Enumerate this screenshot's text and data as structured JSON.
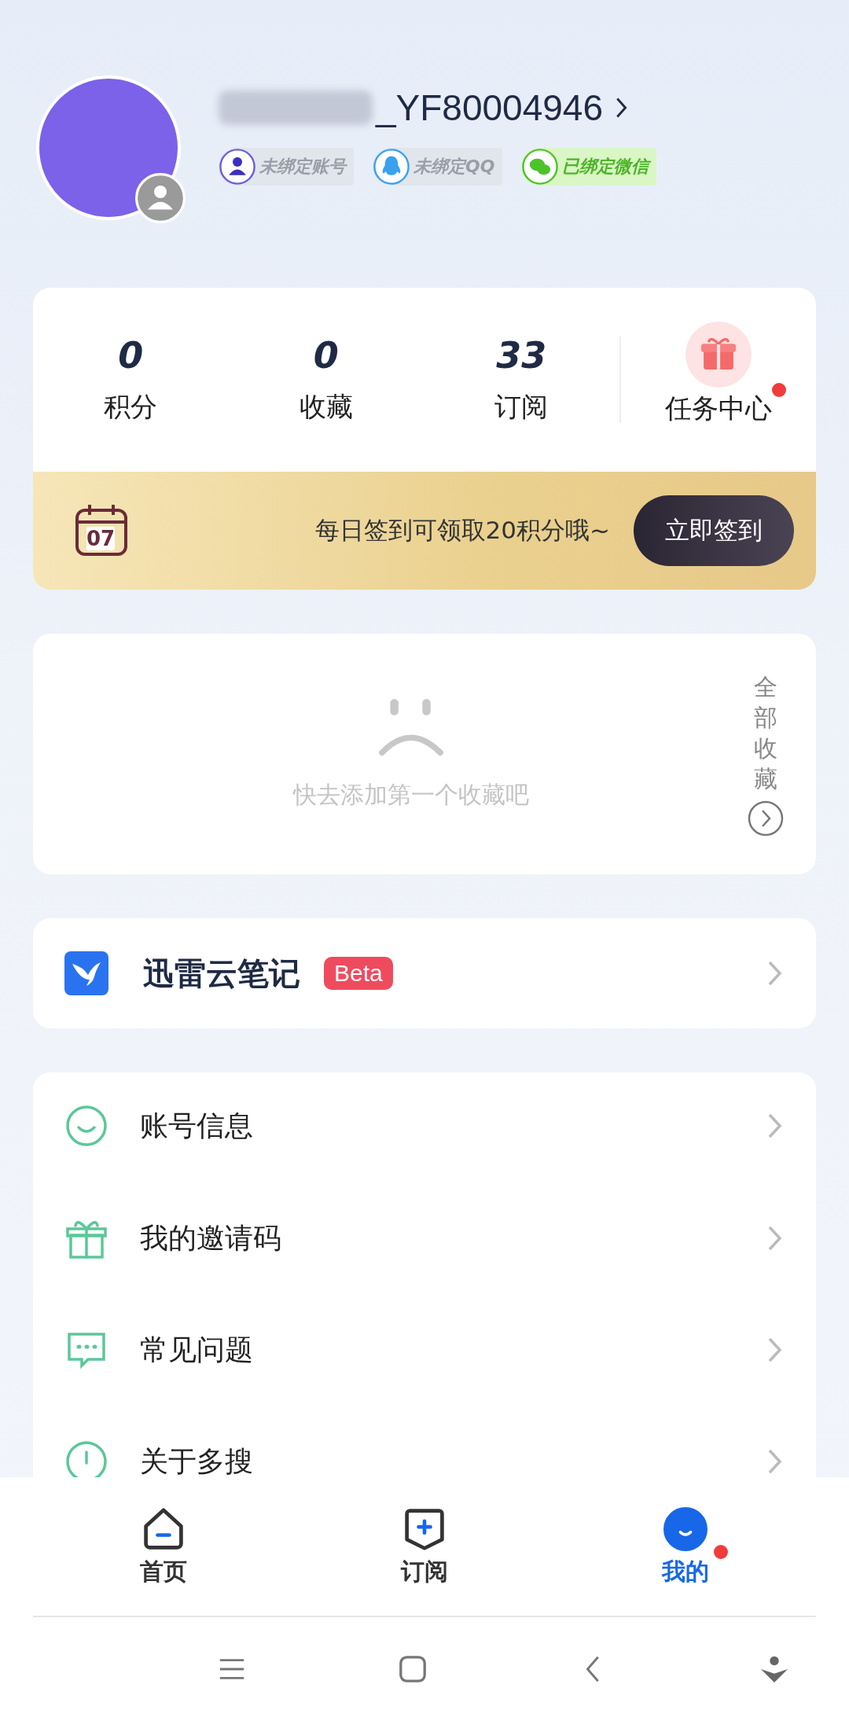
{
  "profile": {
    "username": "_YF80004946",
    "username_blurred": true,
    "bindings": [
      {
        "label": "未绑定账号",
        "bound": false,
        "kind": "account"
      },
      {
        "label": "未绑定QQ",
        "bound": false,
        "kind": "qq"
      },
      {
        "label": "已绑定微信",
        "bound": true,
        "kind": "wechat"
      }
    ]
  },
  "stats": [
    {
      "value": "0",
      "label": "积分"
    },
    {
      "value": "0",
      "label": "收藏"
    },
    {
      "value": "33",
      "label": "订阅"
    }
  ],
  "task_center": {
    "label": "任务中心",
    "badge": true
  },
  "checkin": {
    "day": "07",
    "text": "每日签到可领取20积分哦~",
    "button": "立即签到"
  },
  "favorites": {
    "empty_text": "快去添加第一个收藏吧",
    "all_link": "全部收藏"
  },
  "notes": {
    "label": "迅雷云笔记",
    "tag": "Beta"
  },
  "menu": [
    {
      "label": "账号信息",
      "kind": "smile"
    },
    {
      "label": "我的邀请码",
      "kind": "gift"
    },
    {
      "label": "常见问题",
      "kind": "chat"
    },
    {
      "label": "关于多搜",
      "kind": "info"
    }
  ],
  "tabs": [
    {
      "label": "首页",
      "selected": false,
      "kind": "home",
      "badge": false
    },
    {
      "label": "订阅",
      "selected": false,
      "kind": "subscribe",
      "badge": false
    },
    {
      "label": "我的",
      "selected": true,
      "kind": "me",
      "badge": true
    }
  ]
}
